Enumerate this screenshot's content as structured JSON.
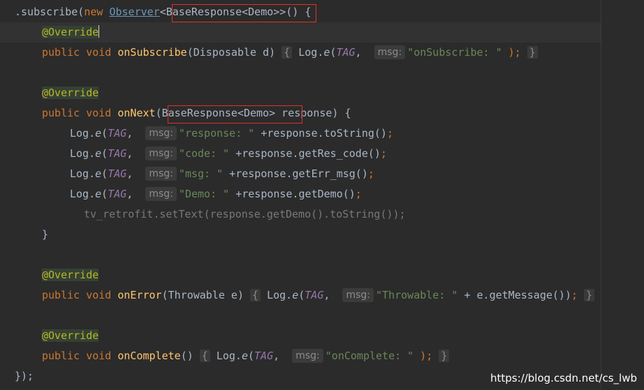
{
  "code": {
    "l1": {
      "pre": ".subscribe(",
      "new": "new",
      "observer": "Observer",
      "generic": "<BaseResponse<Demo>>",
      "post": "() {"
    },
    "l2": {
      "annotation": "@Override"
    },
    "l3": {
      "public": "public",
      "void": "void",
      "fn": "onSubscribe",
      "params": "(Disposable d)",
      "brace": "{",
      "log": "Log.",
      "e": "e",
      "paren": "(",
      "tag": "TAG",
      "comma": ",",
      "hint": "msg:",
      "str": "\"onSubscribe: \"",
      "end": " );",
      "close": "}"
    },
    "l5": {
      "annotation": "@Override"
    },
    "l6": {
      "public": "public",
      "void": "void",
      "fn": "onNext",
      "generic": "(BaseResponse<Demo>",
      "post": " response) {"
    },
    "l7": {
      "log": "Log.",
      "e": "e",
      "paren": "(",
      "tag": "TAG",
      "comma": ",",
      "hint": "msg:",
      "str": "\"response: \"",
      "rest": " +response.toString()",
      "semi": ";"
    },
    "l8": {
      "log": "Log.",
      "e": "e",
      "paren": "(",
      "tag": "TAG",
      "comma": ",",
      "hint": "msg:",
      "str": "\"code: \"",
      "rest": " +response.getRes_code()",
      "semi": ";"
    },
    "l9": {
      "log": "Log.",
      "e": "e",
      "paren": "(",
      "tag": "TAG",
      "comma": ",",
      "hint": "msg:",
      "str": "\"msg: \"",
      "rest": " +response.getErr_msg()",
      "semi": ";"
    },
    "l10": {
      "log": "Log.",
      "e": "e",
      "paren": "(",
      "tag": "TAG",
      "comma": ",",
      "hint": "msg:",
      "str": "\"Demo: \"",
      "rest": " +response.getDemo()",
      "semi": ";"
    },
    "l11": {
      "text": "tv_retrofit.setText(response.getDemo().toString());"
    },
    "l12": {
      "close": "}"
    },
    "l14": {
      "annotation": "@Override"
    },
    "l15": {
      "public": "public",
      "void": "void",
      "fn": "onError",
      "params": "(Throwable e)",
      "brace": "{",
      "log": "Log.",
      "e": "e",
      "paren": "(",
      "tag": "TAG",
      "comma": ",",
      "hint": "msg:",
      "str": "\"Throwable: \"",
      "rest": " + e.getMessage())",
      "semi": ";",
      "close": "}"
    },
    "l17": {
      "annotation": "@Override"
    },
    "l18": {
      "public": "public",
      "void": "void",
      "fn": "onComplete",
      "params": "()",
      "brace": "{",
      "log": "Log.",
      "e": "e",
      "paren": "(",
      "tag": "TAG",
      "comma": ",",
      "hint": "msg:",
      "str": "\"onComplete: \"",
      "end": " );",
      "close": "}"
    },
    "l19": {
      "text": "});"
    }
  },
  "watermark": "https://blog.csdn.net/cs_lwb",
  "colors": {
    "background": "#2b2b2b",
    "keyword": "#cc7832",
    "function": "#ffc66d",
    "string": "#6a8759",
    "annotation": "#bbb529",
    "static_field": "#9876aa",
    "highlight_box": "#e0302c"
  }
}
